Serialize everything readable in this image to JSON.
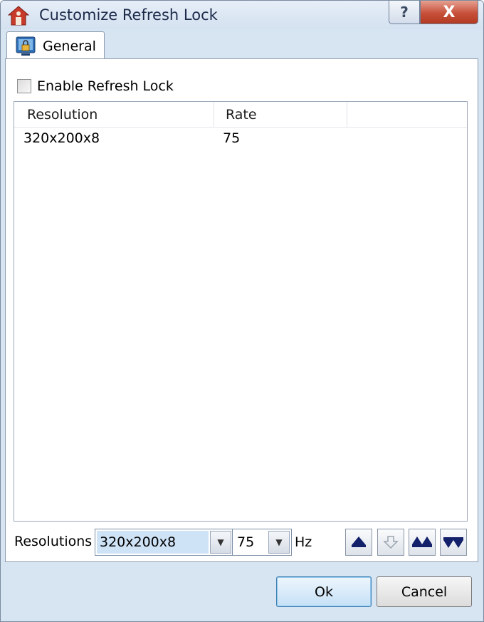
{
  "window": {
    "title": "Customize Refresh Lock",
    "help_label": "?",
    "close_label": "X"
  },
  "tabs": [
    {
      "label": "General",
      "selected": true
    }
  ],
  "general": {
    "enable_label": "Enable Refresh Lock",
    "enable_checked": false,
    "list": {
      "columns": [
        "Resolution",
        "Rate"
      ],
      "rows": [
        {
          "resolution": "320x200x8",
          "rate": "75"
        }
      ]
    },
    "resolutions_label": "Resolutions",
    "resolution_value": "320x200x8",
    "rate_value": "75",
    "hz_label": "Hz",
    "tool_buttons": [
      "move-up-icon",
      "move-down-icon",
      "move-top-icon",
      "move-bottom-icon"
    ]
  },
  "footer": {
    "ok_label": "Ok",
    "cancel_label": "Cancel"
  }
}
